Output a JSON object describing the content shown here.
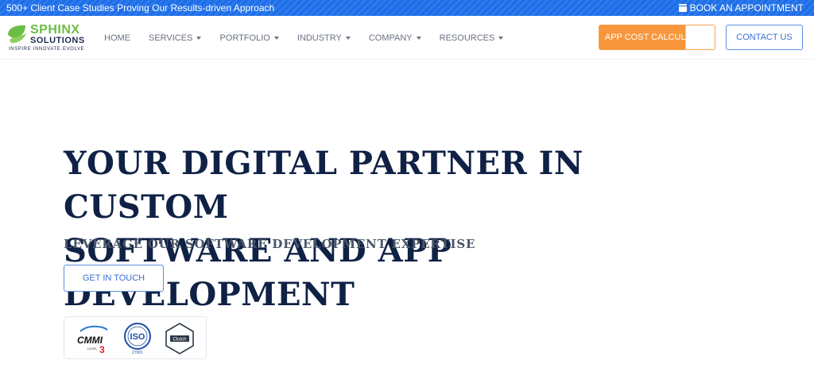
{
  "topbar": {
    "promo_text": "500+ Client Case Studies Proving Our Results-driven Approach",
    "book_label": "BOOK AN APPOINTMENT",
    "book_icon": "calendar-icon"
  },
  "logo": {
    "name_line1": "SPHINX",
    "name_line2": "SOLUTIONS",
    "tagline": "INSPIRE·INNOVATE·EVOLVE"
  },
  "nav": {
    "items": [
      {
        "label": "HOME",
        "has_dropdown": false
      },
      {
        "label": "SERVICES",
        "has_dropdown": true
      },
      {
        "label": "PORTFOLIO",
        "has_dropdown": true
      },
      {
        "label": "INDUSTRY",
        "has_dropdown": true
      },
      {
        "label": "COMPANY",
        "has_dropdown": true
      },
      {
        "label": "RESOURCES",
        "has_dropdown": true
      }
    ]
  },
  "header_buttons": {
    "calc_label": "APP COST CALCULATOR",
    "contact_label": "CONTACT US"
  },
  "hero": {
    "title_line1": "YOUR DIGITAL PARTNER IN CUSTOM",
    "title_line2": "SOFTWARE AND APP DEVELOPMENT",
    "subtitle": "LEVERAGE OUR SOFTWARE DEVELOPMENT EXPERTISE",
    "cta_label": "GET IN TOUCH"
  },
  "badges": {
    "cmmi": {
      "text": "CMMI",
      "level": "3",
      "level_label": "LEVEL"
    },
    "iso": {
      "text": "ISO",
      "number": "27001"
    },
    "clutch": {
      "text": "Clutch"
    }
  },
  "colors": {
    "topbar": "#1d6ee8",
    "brand_green": "#6cbd45",
    "heading_navy": "#0f2145",
    "accent_orange": "#f7963a",
    "link_blue": "#3b6fd1"
  }
}
